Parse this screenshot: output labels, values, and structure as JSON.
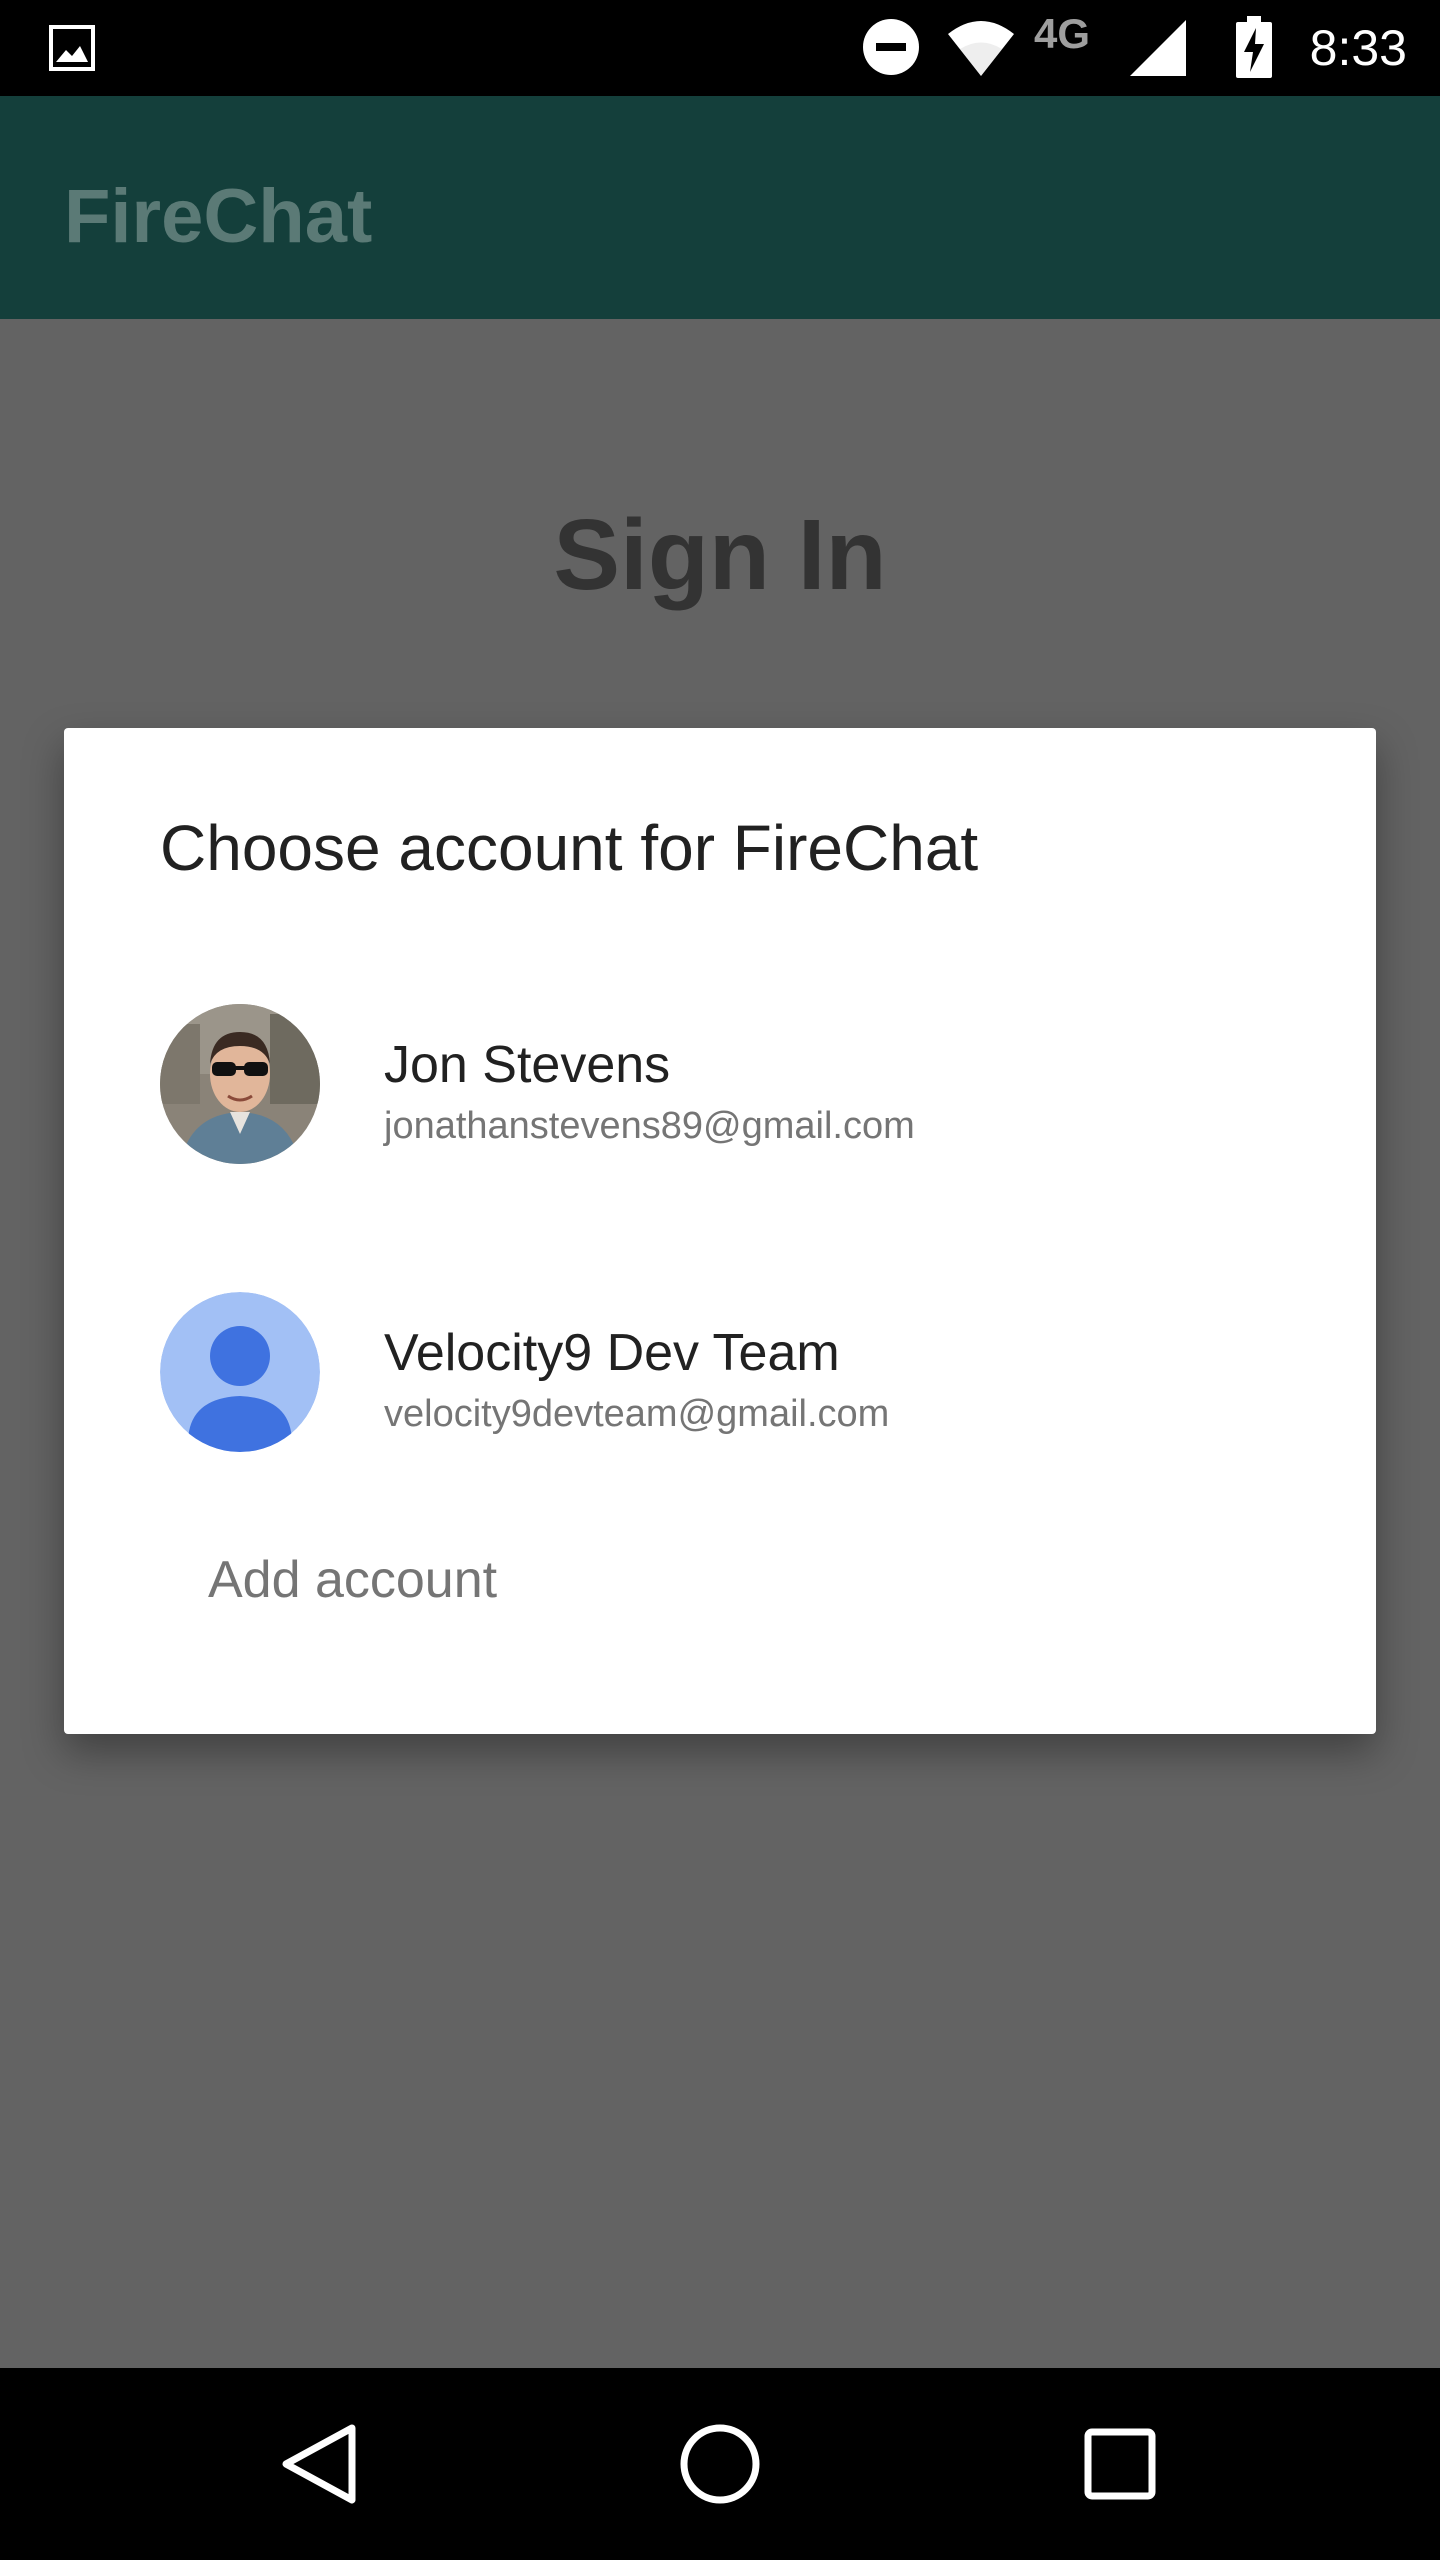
{
  "status_bar": {
    "time": "8:33",
    "network_label": "4G",
    "icons": [
      "image-notification-icon",
      "do-not-disturb-icon",
      "wifi-icon",
      "4g-lte-icon",
      "signal-icon",
      "battery-charging-icon"
    ]
  },
  "app_bar": {
    "title": "FireChat",
    "color": "#143f3b"
  },
  "page": {
    "heading": "Sign In"
  },
  "dialog": {
    "title": "Choose account for FireChat",
    "accounts": [
      {
        "name": "Jon Stevens",
        "email": "jonathanstevens89@gmail.com",
        "avatar": "profile-photo"
      },
      {
        "name": "Velocity9 Dev Team",
        "email": "velocity9devteam@gmail.com",
        "avatar": "default-avatar-icon"
      }
    ],
    "add_account_label": "Add account"
  },
  "nav_bar": {
    "icons": [
      "back-icon",
      "home-icon",
      "recents-icon"
    ]
  }
}
